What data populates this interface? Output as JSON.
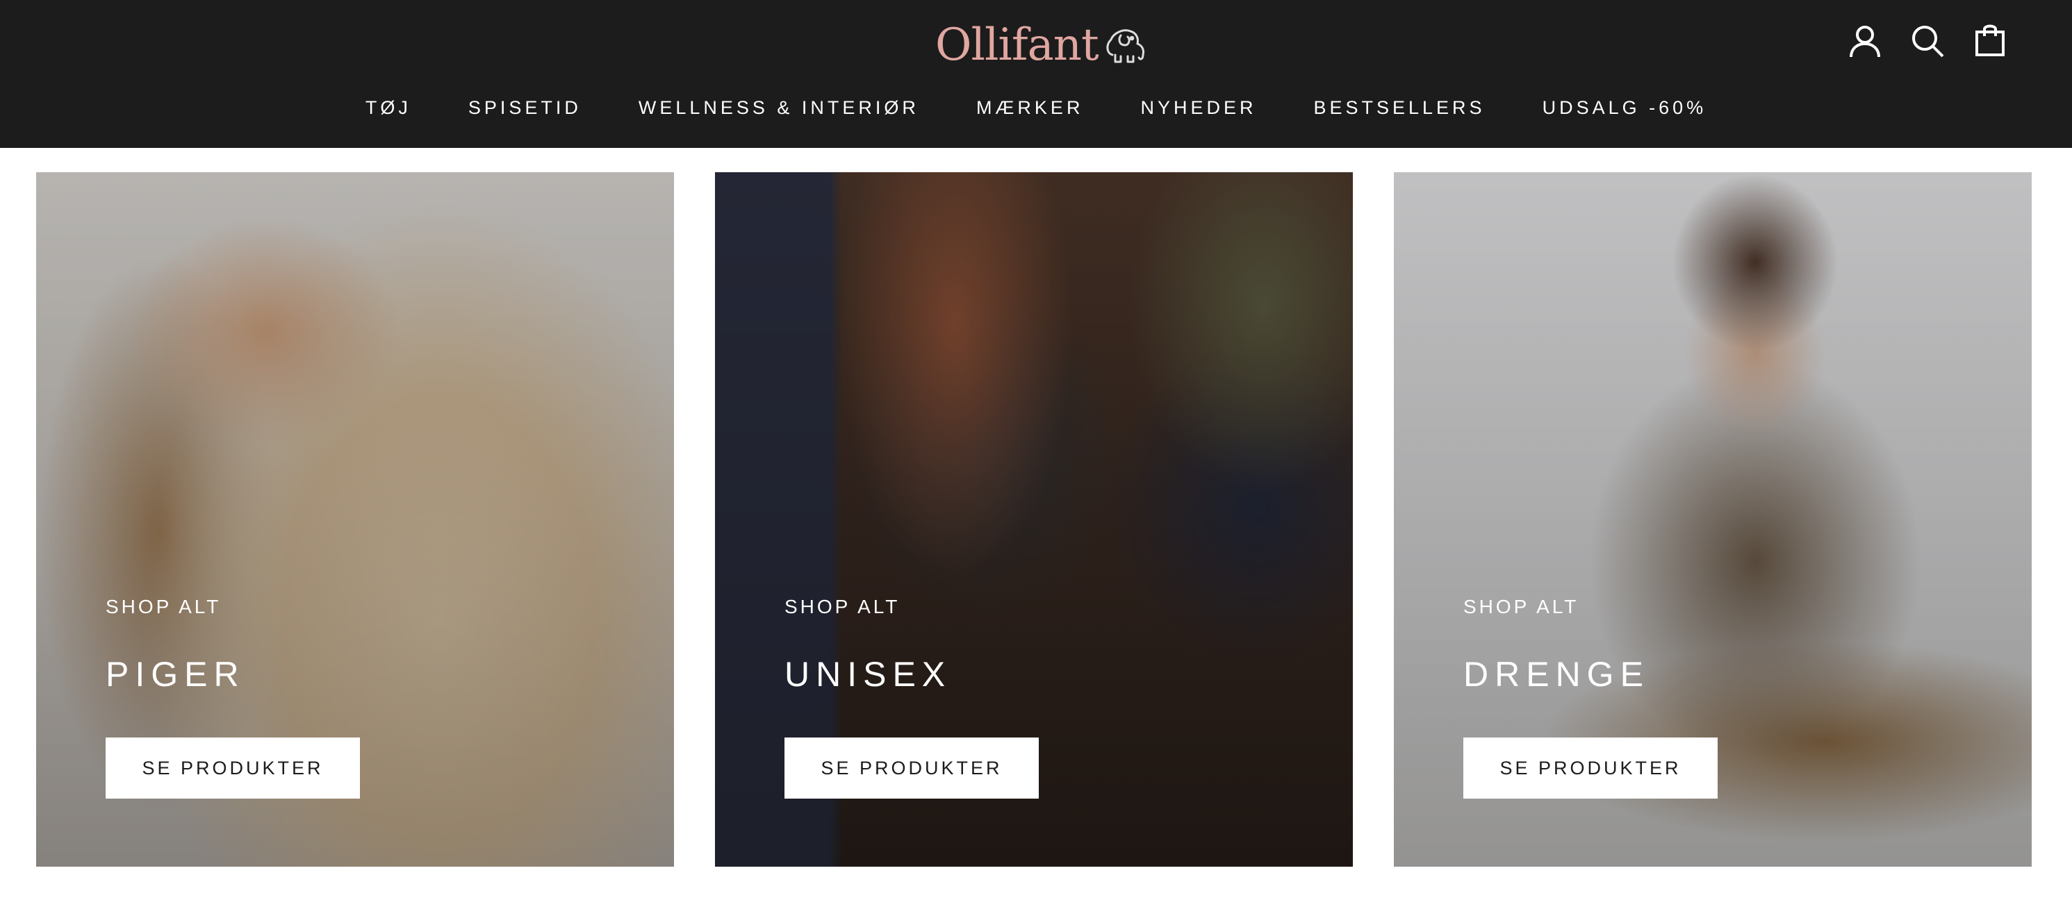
{
  "brand": {
    "name": "Ollifant",
    "logo_color": "#e0a6a0"
  },
  "header": {
    "background": "#1c1c1c",
    "icons": [
      "account-icon",
      "search-icon",
      "cart-icon"
    ]
  },
  "nav": {
    "items": [
      {
        "label": "TØJ"
      },
      {
        "label": "SPISETID"
      },
      {
        "label": "WELLNESS & INTERIØR"
      },
      {
        "label": "MÆRKER"
      },
      {
        "label": "NYHEDER"
      },
      {
        "label": "BESTSELLERS"
      },
      {
        "label": "UDSALG -60%"
      }
    ]
  },
  "cards": [
    {
      "eyebrow": "SHOP ALT",
      "title": "PIGER",
      "button": "SE PRODUKTER"
    },
    {
      "eyebrow": "SHOP ALT",
      "title": "UNISEX",
      "button": "SE PRODUKTER"
    },
    {
      "eyebrow": "SHOP ALT",
      "title": "DRENGE",
      "button": "SE PRODUKTER"
    }
  ]
}
